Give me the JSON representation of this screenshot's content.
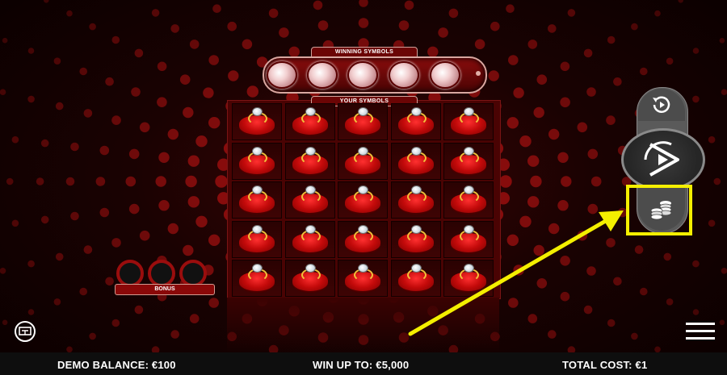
{
  "header": {
    "winning_symbols_label": "WINNING SYMBOLS",
    "your_symbols_label": "YOUR SYMBOLS"
  },
  "winning_symbols": [
    "diamond",
    "diamond",
    "diamond",
    "diamond",
    "diamond"
  ],
  "grid": {
    "rows": 5,
    "cols": 5,
    "symbol": "ring-box"
  },
  "bonus": {
    "label": "BONUS",
    "slots": 3
  },
  "controls": {
    "autoplay_icon": "autoplay-icon",
    "play_icon": "play-icon",
    "stake_icon": "coins-icon",
    "history_icon": "history-icon",
    "menu_icon": "hamburger-menu-icon"
  },
  "footer": {
    "balance_label": "DEMO BALANCE:",
    "balance_value": "€100",
    "win_label": "WIN UP TO:",
    "win_value": "€5,000",
    "cost_label": "TOTAL COST:",
    "cost_value": "€1"
  },
  "colors": {
    "highlight": "#f4ef00",
    "accent_red": "#c30a0a",
    "gold": "#f2c23a"
  }
}
